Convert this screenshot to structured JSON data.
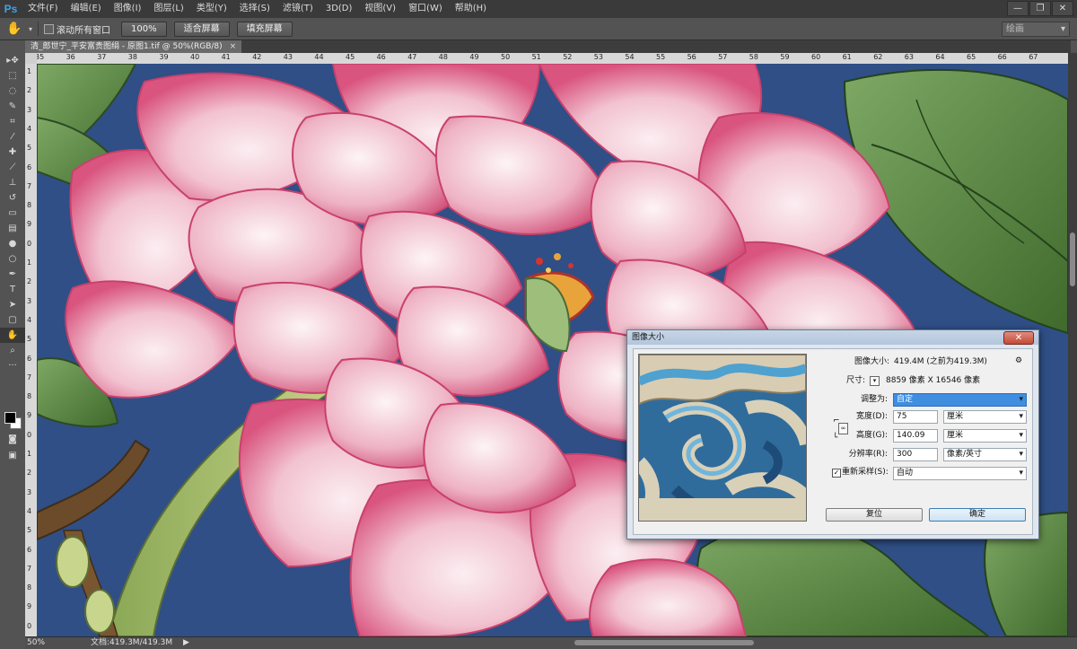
{
  "app": {
    "logo": "Ps",
    "menu": [
      "文件(F)",
      "编辑(E)",
      "图像(I)",
      "图层(L)",
      "类型(Y)",
      "选择(S)",
      "滤镜(T)",
      "3D(D)",
      "视图(V)",
      "窗口(W)",
      "帮助(H)"
    ],
    "window_controls": [
      "—",
      "❐",
      "✕"
    ]
  },
  "options_bar": {
    "tool_icon": "hand-icon",
    "scroll_all_label": "滚动所有窗口",
    "buttons": [
      "100%",
      "适合屏幕",
      "填充屏幕"
    ],
    "workspace": "绘画"
  },
  "document_tab": {
    "title": "清_郎世宁_平安富贵图绢 - 原图1.tif @ 50%(RGB/8)",
    "close": "×"
  },
  "rulers": {
    "top": [
      "35",
      "36",
      "37",
      "38",
      "39",
      "40",
      "41",
      "42",
      "43",
      "44",
      "45",
      "46",
      "47",
      "48",
      "49",
      "50",
      "51",
      "52",
      "53",
      "54",
      "55",
      "56",
      "57",
      "58",
      "59",
      "60",
      "61",
      "62",
      "63",
      "64",
      "65",
      "66",
      "67"
    ],
    "left": [
      "1",
      "2",
      "3",
      "4",
      "5",
      "6",
      "7",
      "8",
      "9",
      "0",
      "1",
      "2",
      "3",
      "4",
      "5",
      "6",
      "7",
      "8",
      "9",
      "0",
      "1",
      "2",
      "3",
      "4",
      "5",
      "6",
      "7",
      "8",
      "9",
      "0"
    ]
  },
  "status": {
    "zoom": "50%",
    "doc": "文档:419.3M/419.3M",
    "arrow": "▶"
  },
  "dialog": {
    "title": "图像大小",
    "close": "✕",
    "image_size_label": "图像大小:",
    "image_size_value": "419.4M (之前为419.3M)",
    "dimensions_label": "尺寸:",
    "dimensions_value": "8859 像素  X  16546 像素",
    "fit_to_label": "调整为:",
    "fit_to_value": "自定",
    "width_label": "宽度(D):",
    "width_value": "75",
    "width_unit": "厘米",
    "height_label": "高度(G):",
    "height_value": "140.09",
    "height_unit": "厘米",
    "resolution_label": "分辨率(R):",
    "resolution_value": "300",
    "resolution_unit": "像素/英寸",
    "resample_label": "重新采样(S):",
    "resample_checked": "✓",
    "resample_value": "自动",
    "reset_button": "复位",
    "ok_button": "确定",
    "gear_icon": "⚙"
  },
  "colors": {
    "peony_pink": "#e8789a",
    "peony_light": "#f6dbe2",
    "leaf_green": "#4f7d3a",
    "background_blue": "#2f4f86"
  }
}
